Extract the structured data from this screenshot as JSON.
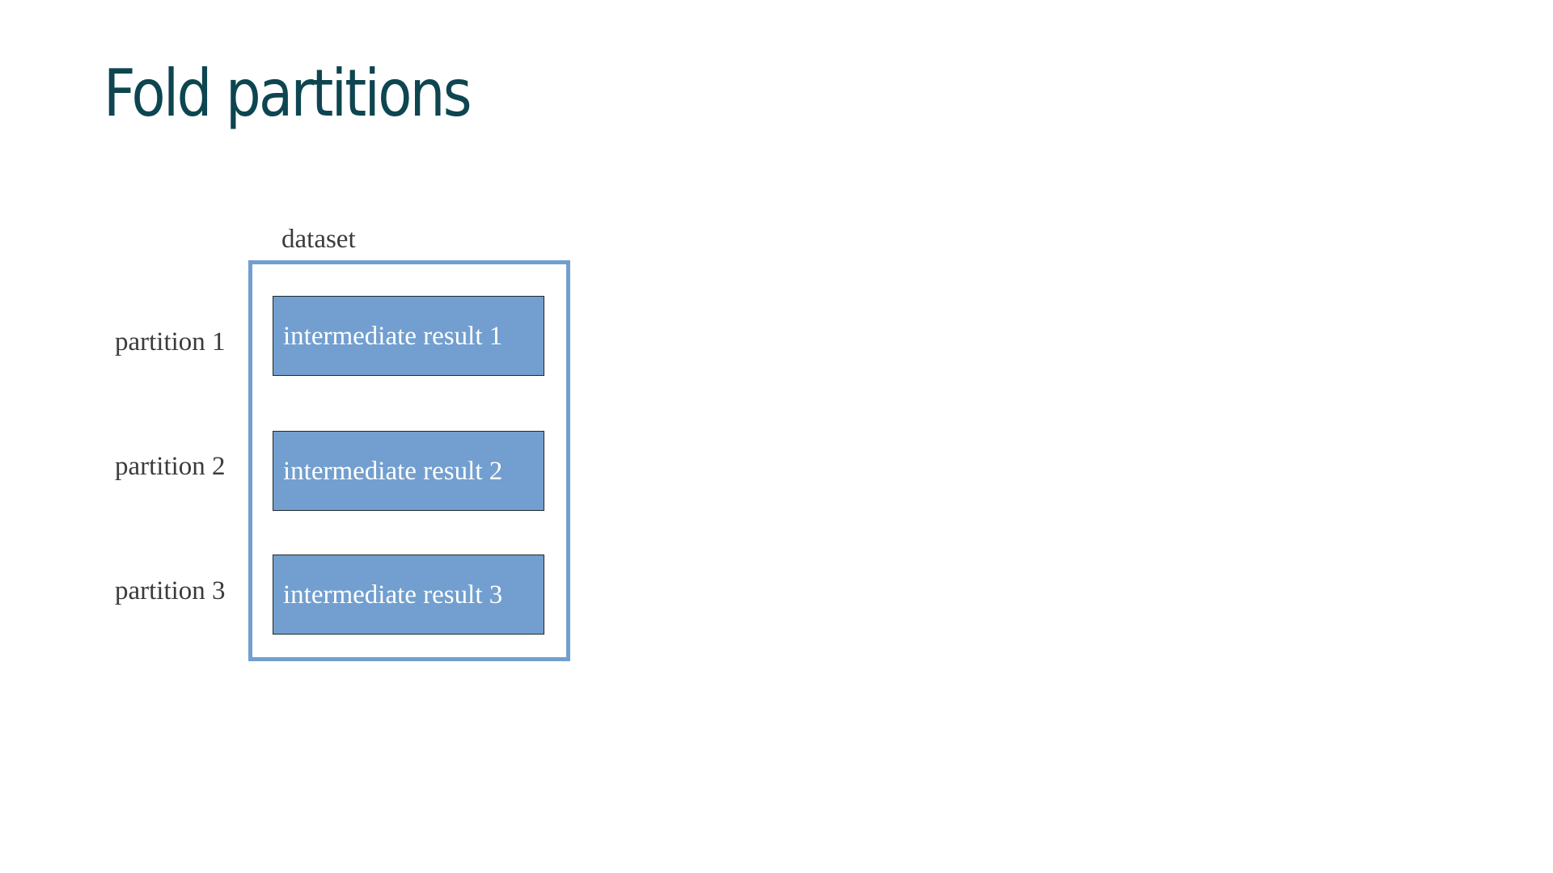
{
  "title": "Fold partitions",
  "diagram": {
    "dataset_label": "dataset",
    "partitions": [
      {
        "label": "partition 1",
        "result": "intermediate result 1"
      },
      {
        "label": "partition 2",
        "result": "intermediate result 2"
      },
      {
        "label": "partition 3",
        "result": "intermediate result 3"
      }
    ]
  },
  "colors": {
    "title": "#0d4550",
    "dataset_border": "#729fcf",
    "result_fill": "#729fcf",
    "text": "#3b3b3b",
    "result_text": "#ffffff"
  }
}
